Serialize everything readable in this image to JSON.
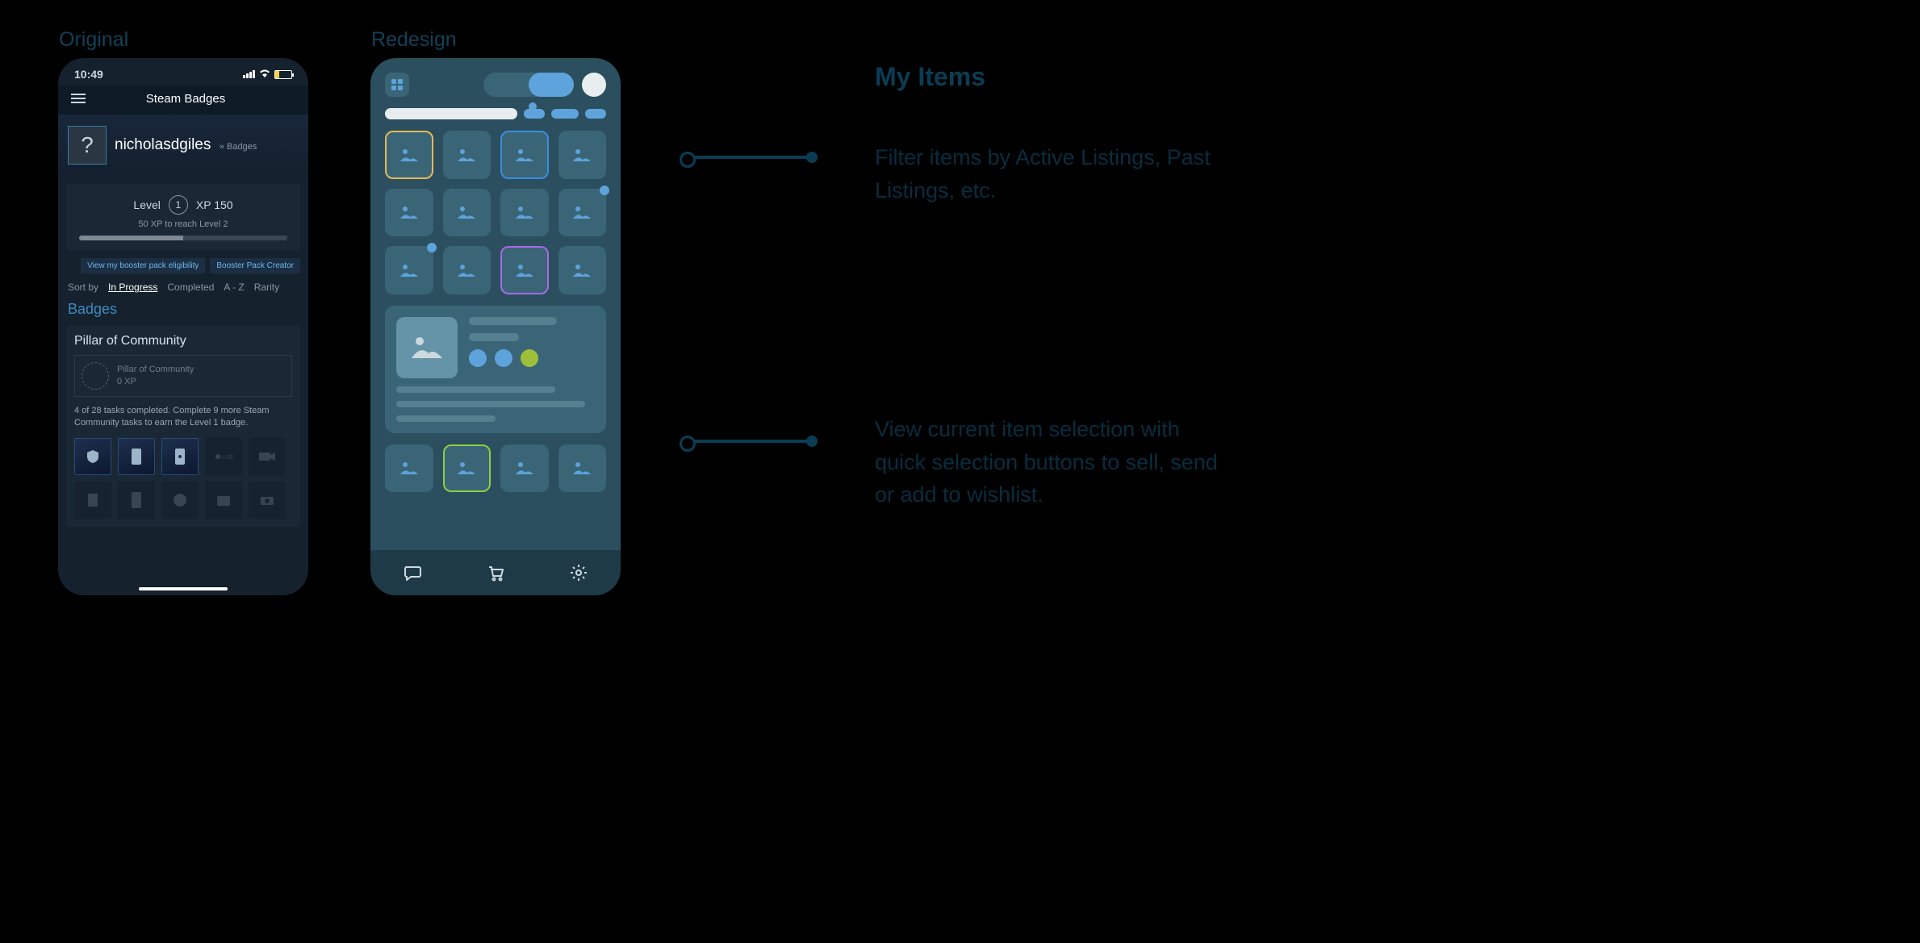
{
  "labels": {
    "original": "Original",
    "redesign": "Redesign"
  },
  "statusbar": {
    "time": "10:49"
  },
  "titlebar": {
    "title": "Steam Badges"
  },
  "user": {
    "name": "nicholasdgiles",
    "breadcrumb": "» Badges",
    "avatar_glyph": "?"
  },
  "level": {
    "level_label": "Level",
    "level_value": "1",
    "xp_label": "XP 150",
    "sub": "50 XP to reach Level 2"
  },
  "pills": {
    "eligibility": "View my booster pack eligibility",
    "creator": "Booster Pack Creator"
  },
  "sort": {
    "label": "Sort by",
    "in_progress": "In Progress",
    "completed": "Completed",
    "az": "A - Z",
    "rarity": "Rarity"
  },
  "badges_header": "Badges",
  "badge": {
    "title": "Pillar of Community",
    "name": "Pillar of Community",
    "xp": "0 XP",
    "desc": "4 of 28 tasks completed. Complete 9 more Steam Community tasks to earn the Level 1 badge."
  },
  "annotations": {
    "title": "My Items",
    "filter": "Filter items by Active Listings, Past Listings, etc.",
    "detail": "View current item selection with quick selection buttons to sell, send or add to wishlist."
  }
}
